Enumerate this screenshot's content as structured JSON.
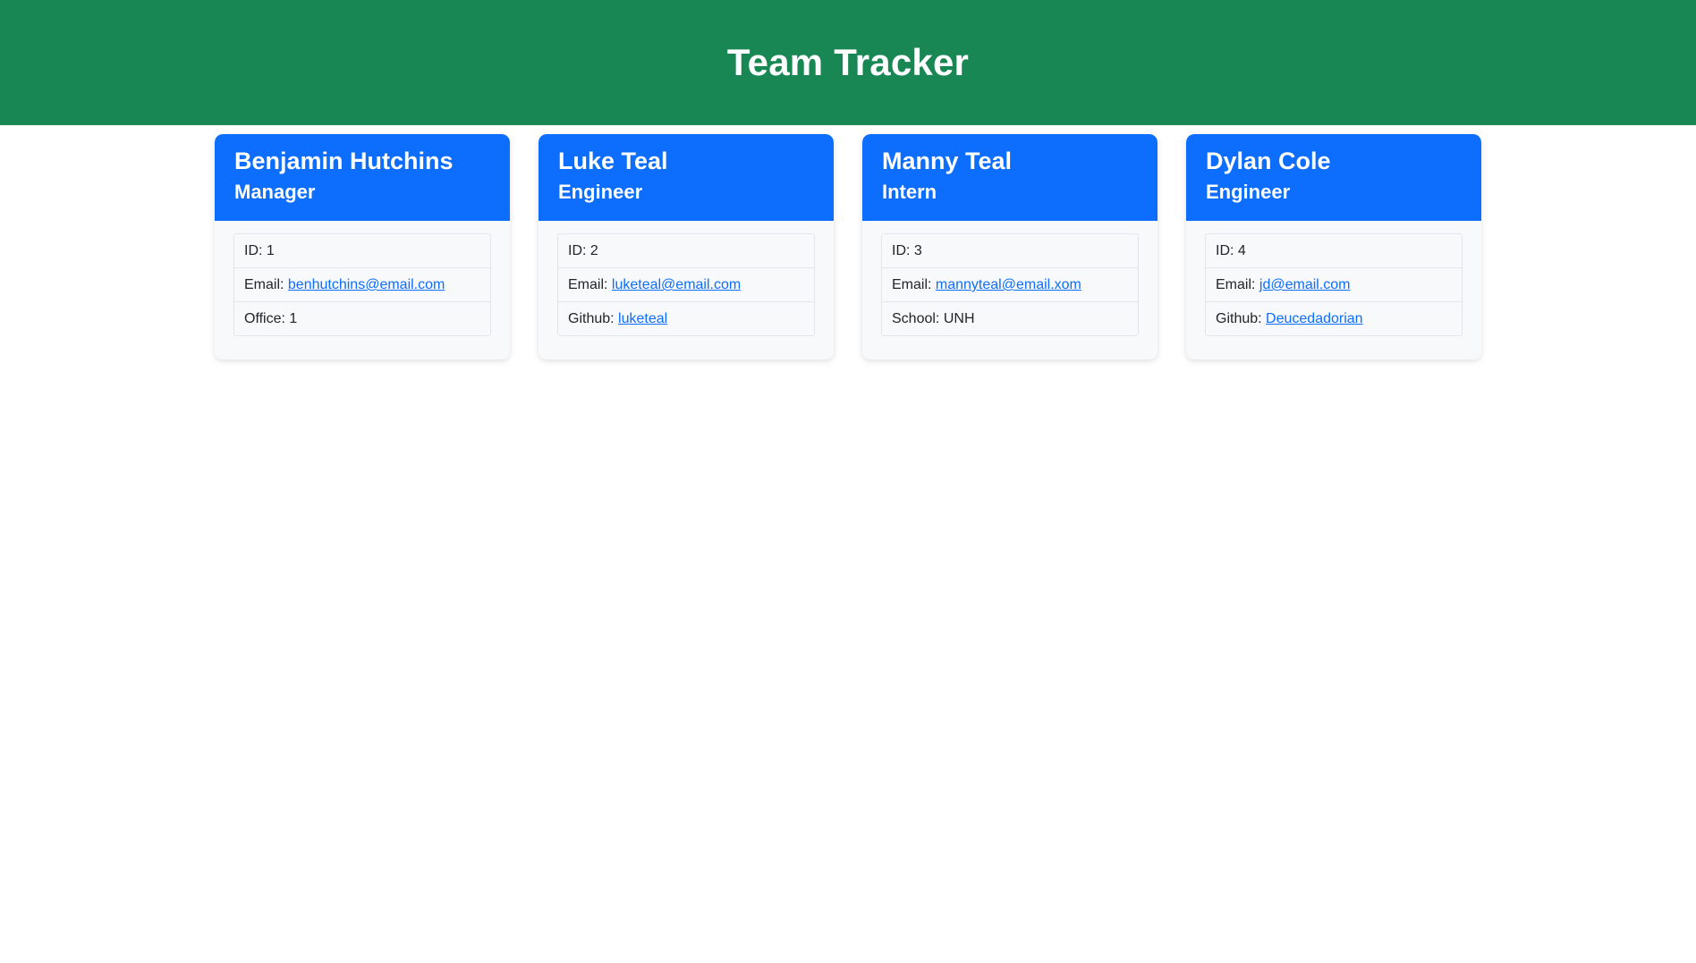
{
  "header": {
    "title": "Team Tracker",
    "background_color": "#198754",
    "text_color": "#ffffff"
  },
  "theme": {
    "page_background": "#ffffff",
    "card_header_color": "#0d6efd",
    "card_body_color": "#f8f9fa",
    "link_color": "#0d6efd",
    "text_color": "#212529",
    "border_color": "#e3e5e8"
  },
  "cards": [
    {
      "name": "Benjamin Hutchins",
      "role": "Manager",
      "details": [
        {
          "label": "ID:",
          "value": "1",
          "is_link": false
        },
        {
          "label": "Email:",
          "value": "benhutchins@email.com",
          "is_link": true
        },
        {
          "label": "Office:",
          "value": "1",
          "is_link": false
        }
      ]
    },
    {
      "name": "Luke Teal",
      "role": "Engineer",
      "details": [
        {
          "label": "ID:",
          "value": "2",
          "is_link": false
        },
        {
          "label": "Email:",
          "value": "luketeal@email.com",
          "is_link": true
        },
        {
          "label": "Github:",
          "value": "luketeal",
          "is_link": true
        }
      ]
    },
    {
      "name": "Manny Teal",
      "role": "Intern",
      "details": [
        {
          "label": "ID:",
          "value": "3",
          "is_link": false
        },
        {
          "label": "Email:",
          "value": "mannyteal@email.xom",
          "is_link": true
        },
        {
          "label": "School:",
          "value": "UNH",
          "is_link": false
        }
      ]
    },
    {
      "name": "Dylan Cole",
      "role": "Engineer",
      "details": [
        {
          "label": "ID:",
          "value": "4",
          "is_link": false
        },
        {
          "label": "Email:",
          "value": "jd@email.com",
          "is_link": true
        },
        {
          "label": "Github:",
          "value": "Deucedadorian",
          "is_link": true
        }
      ]
    }
  ]
}
